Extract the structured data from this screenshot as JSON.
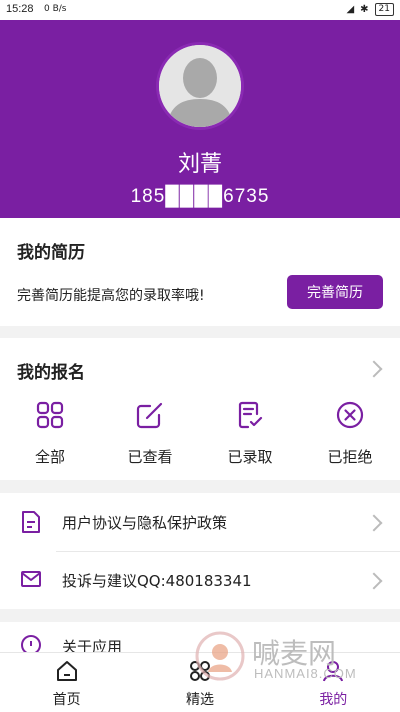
{
  "status_bar": {
    "time": "15:28",
    "network": "0 B/s",
    "battery": "21"
  },
  "profile": {
    "name": "刘菁",
    "phone": "185████6735"
  },
  "resume": {
    "title": "我的简历",
    "description": "完善简历能提高您的录取率哦!",
    "button": "完善简历"
  },
  "enrollment": {
    "title": "我的报名",
    "items": [
      {
        "label": "全部",
        "icon": "grid-icon"
      },
      {
        "label": "已查看",
        "icon": "edit-icon"
      },
      {
        "label": "已录取",
        "icon": "document-check-icon"
      },
      {
        "label": "已拒绝",
        "icon": "close-circle-icon"
      }
    ]
  },
  "menu": [
    {
      "label": "用户协议与隐私保护政策",
      "icon": "document-icon"
    },
    {
      "label": "投诉与建议QQ:480183341",
      "icon": "mail-icon"
    },
    {
      "label": "关于应用",
      "icon": "info-icon"
    }
  ],
  "tabs": [
    {
      "label": "首页",
      "icon": "home-icon"
    },
    {
      "label": "精选",
      "icon": "featured-icon"
    },
    {
      "label": "我的",
      "icon": "profile-icon"
    }
  ],
  "active_tab": "我的",
  "watermark": {
    "main": "喊麦网",
    "sub": "HANMAI8.COM"
  },
  "colors": {
    "primary": "#7a1fa2",
    "background": "#f2f2f2"
  }
}
